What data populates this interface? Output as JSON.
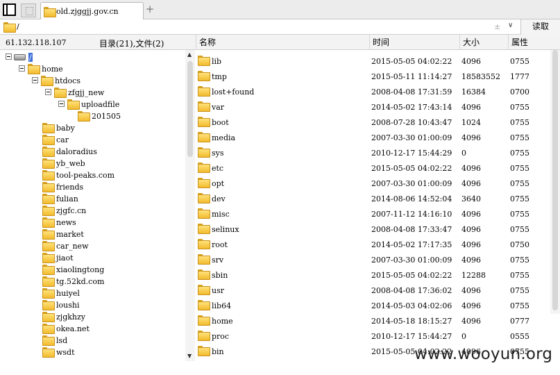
{
  "tab": {
    "title": "old.zjggjj.gov.cn",
    "add_symbol": "+"
  },
  "pathbar": {
    "path": "/",
    "ctl_symbol": "±",
    "dropdown_symbol": "∨",
    "read_label": "读取"
  },
  "info": {
    "ip": "61.132.118.107",
    "dir_count": "目录(21),文件(2)"
  },
  "headers": {
    "name": "名称",
    "time": "时间",
    "size": "大小",
    "perm": "属性"
  },
  "tree": [
    {
      "label": "/",
      "level": 0,
      "toggle": true,
      "icon": "drive",
      "selected": true
    },
    {
      "label": "home",
      "level": 1,
      "toggle": true,
      "icon": "folder"
    },
    {
      "label": "htdocs",
      "level": 2,
      "toggle": true,
      "icon": "folder"
    },
    {
      "label": "zfgjj_new",
      "level": 3,
      "toggle": true,
      "icon": "folder"
    },
    {
      "label": "uploadfile",
      "level": 4,
      "toggle": true,
      "icon": "folder"
    },
    {
      "label": "201505",
      "level": 5,
      "toggle": false,
      "icon": "folder"
    },
    {
      "label": "baby",
      "level": 3,
      "toggle": false,
      "icon": "folder"
    },
    {
      "label": "car",
      "level": 3,
      "toggle": false,
      "icon": "folder"
    },
    {
      "label": "daloradius",
      "level": 3,
      "toggle": false,
      "icon": "folder"
    },
    {
      "label": "yb_web",
      "level": 3,
      "toggle": false,
      "icon": "folder"
    },
    {
      "label": "tool-peaks.com",
      "level": 3,
      "toggle": false,
      "icon": "folder"
    },
    {
      "label": "friends",
      "level": 3,
      "toggle": false,
      "icon": "folder"
    },
    {
      "label": "fulian",
      "level": 3,
      "toggle": false,
      "icon": "folder"
    },
    {
      "label": "zjgfc.cn",
      "level": 3,
      "toggle": false,
      "icon": "folder"
    },
    {
      "label": "news",
      "level": 3,
      "toggle": false,
      "icon": "folder"
    },
    {
      "label": "market",
      "level": 3,
      "toggle": false,
      "icon": "folder"
    },
    {
      "label": "car_new",
      "level": 3,
      "toggle": false,
      "icon": "folder"
    },
    {
      "label": "jiaot",
      "level": 3,
      "toggle": false,
      "icon": "folder"
    },
    {
      "label": "xiaolingtong",
      "level": 3,
      "toggle": false,
      "icon": "folder"
    },
    {
      "label": "tg.52kd.com",
      "level": 3,
      "toggle": false,
      "icon": "folder"
    },
    {
      "label": "huiyel",
      "level": 3,
      "toggle": false,
      "icon": "folder"
    },
    {
      "label": "loushi",
      "level": 3,
      "toggle": false,
      "icon": "folder"
    },
    {
      "label": "zjgkhzy",
      "level": 3,
      "toggle": false,
      "icon": "folder"
    },
    {
      "label": "okea.net",
      "level": 3,
      "toggle": false,
      "icon": "folder"
    },
    {
      "label": "lsd",
      "level": 3,
      "toggle": false,
      "icon": "folder"
    },
    {
      "label": "wsdt",
      "level": 3,
      "toggle": false,
      "icon": "folder"
    }
  ],
  "files": [
    {
      "name": "lib",
      "time": "2015-05-05 04:02:22",
      "size": "4096",
      "perm": "0755"
    },
    {
      "name": "tmp",
      "time": "2015-05-11 11:14:27",
      "size": "18583552",
      "perm": "1777"
    },
    {
      "name": "lost+found",
      "time": "2008-04-08 17:31:59",
      "size": "16384",
      "perm": "0700"
    },
    {
      "name": "var",
      "time": "2014-05-02 17:43:14",
      "size": "4096",
      "perm": "0755"
    },
    {
      "name": "boot",
      "time": "2008-07-28 10:43:47",
      "size": "1024",
      "perm": "0755"
    },
    {
      "name": "media",
      "time": "2007-03-30 01:00:09",
      "size": "4096",
      "perm": "0755"
    },
    {
      "name": "sys",
      "time": "2010-12-17 15:44:29",
      "size": "0",
      "perm": "0755"
    },
    {
      "name": "etc",
      "time": "2015-05-05 04:02:22",
      "size": "4096",
      "perm": "0755"
    },
    {
      "name": "opt",
      "time": "2007-03-30 01:00:09",
      "size": "4096",
      "perm": "0755"
    },
    {
      "name": "dev",
      "time": "2014-08-06 14:52:04",
      "size": "3640",
      "perm": "0755"
    },
    {
      "name": "misc",
      "time": "2007-11-12 14:16:10",
      "size": "4096",
      "perm": "0755"
    },
    {
      "name": "selinux",
      "time": "2008-04-08 17:33:47",
      "size": "4096",
      "perm": "0755"
    },
    {
      "name": "root",
      "time": "2014-05-02 17:17:35",
      "size": "4096",
      "perm": "0750"
    },
    {
      "name": "srv",
      "time": "2007-03-30 01:00:09",
      "size": "4096",
      "perm": "0755"
    },
    {
      "name": "sbin",
      "time": "2015-05-05 04:02:22",
      "size": "12288",
      "perm": "0755"
    },
    {
      "name": "usr",
      "time": "2008-04-08 17:36:02",
      "size": "4096",
      "perm": "0755"
    },
    {
      "name": "lib64",
      "time": "2014-05-03 04:02:06",
      "size": "4096",
      "perm": "0755"
    },
    {
      "name": "home",
      "time": "2014-05-18 18:15:27",
      "size": "4096",
      "perm": "0777"
    },
    {
      "name": "proc",
      "time": "2010-12-17 15:44:27",
      "size": "0",
      "perm": "0555"
    },
    {
      "name": "bin",
      "time": "2015-05-05 04:02:22",
      "size": "4096",
      "perm": "0755"
    }
  ],
  "watermark": "www.wooyun.org",
  "colors": {
    "selection": "#3d6fd9",
    "folder": "#f2bb2d"
  }
}
